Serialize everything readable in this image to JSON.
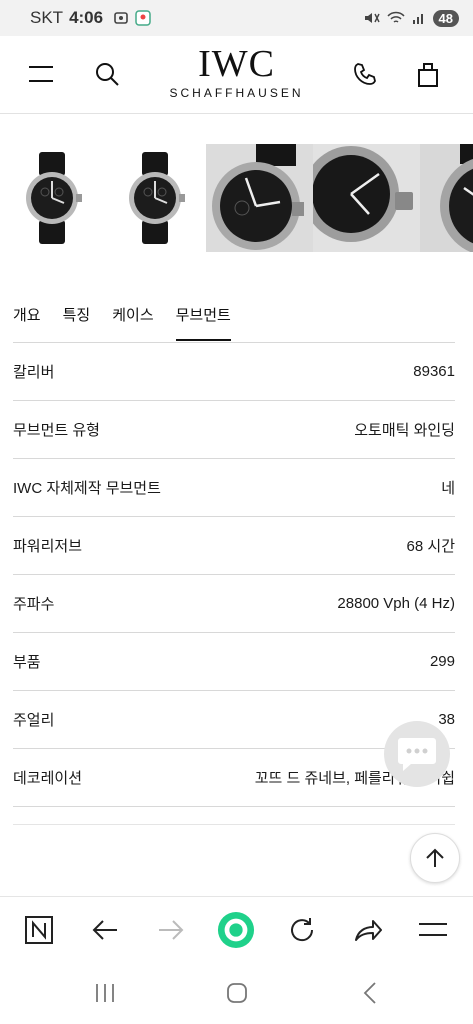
{
  "status_bar": {
    "carrier": "SKT",
    "time": "4:06",
    "battery": "48"
  },
  "header": {
    "brand": "IWC",
    "brand_sub": "SCHAFFHAUSEN",
    "icons": [
      "menu-icon",
      "search-icon",
      "phone-icon",
      "shopping-bag-icon"
    ]
  },
  "gallery": {
    "images": [
      "watch-front",
      "watch-front-2",
      "watch-closeup-dial",
      "watch-closeup-crown",
      "watch-closeup-dial-2"
    ]
  },
  "tabs": [
    {
      "label": "개요",
      "active": false
    },
    {
      "label": "특징",
      "active": false
    },
    {
      "label": "케이스",
      "active": false
    },
    {
      "label": "무브먼트",
      "active": true
    }
  ],
  "specs": [
    {
      "label": "칼리버",
      "value": "89361"
    },
    {
      "label": "무브먼트 유형",
      "value": "오토매틱 와인딩"
    },
    {
      "label": "IWC 자체제작 무브먼트",
      "value": "네"
    },
    {
      "label": "파워리저브",
      "value": "68 시간"
    },
    {
      "label": "주파수",
      "value": "28800 Vph (4 Hz)"
    },
    {
      "label": "부품",
      "value": "299"
    },
    {
      "label": "주얼리",
      "value": "38"
    },
    {
      "label": "데코레이션",
      "value": "꼬뜨 드 쥬네브, 페를라쥬 피니쉽"
    }
  ],
  "colors": {
    "accent_green": "#1fd18a",
    "text": "#1a1a1a",
    "divider": "#d8d8d8"
  },
  "browser_toolbar": {
    "icons": [
      "n-home-icon",
      "back-arrow-icon",
      "forward-arrow-icon",
      "green-dot-icon",
      "refresh-icon",
      "share-icon",
      "menu-lines-icon"
    ]
  }
}
